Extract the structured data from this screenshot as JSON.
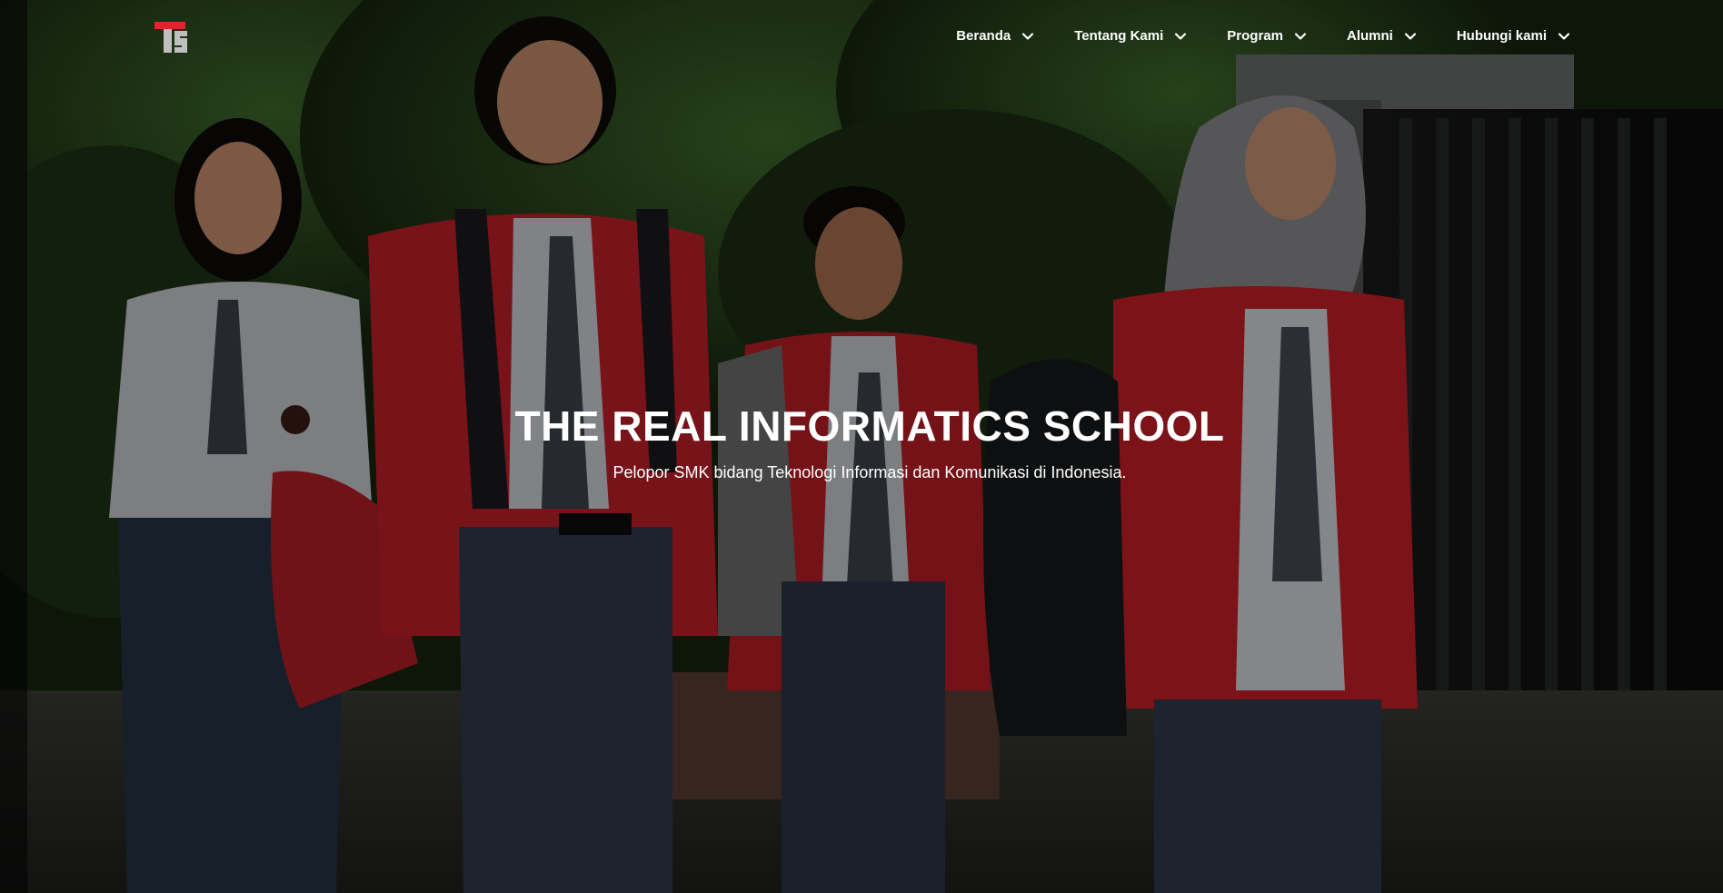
{
  "nav": {
    "items": [
      {
        "label": "Beranda",
        "icon": "chevron-down-icon"
      },
      {
        "label": "Tentang Kami",
        "icon": "chevron-down-icon"
      },
      {
        "label": "Program",
        "icon": "chevron-down-icon"
      },
      {
        "label": "Alumni",
        "icon": "chevron-down-icon"
      },
      {
        "label": "Hubungi kami",
        "icon": "chevron-down-icon"
      }
    ]
  },
  "logo": {
    "icon": "school-logo-icon",
    "colors": {
      "accent": "#e0262c",
      "neutral": "#bfbfbf"
    }
  },
  "hero": {
    "title": "THE REAL INFORMATICS SCHOOL",
    "subtitle": "Pelopor SMK bidang Teknologi Informasi dan Komunikasi di Indonesia."
  },
  "colors": {
    "text": "#ffffff",
    "jacket_red": "#c0202a",
    "foliage": "#1e3a1a"
  }
}
